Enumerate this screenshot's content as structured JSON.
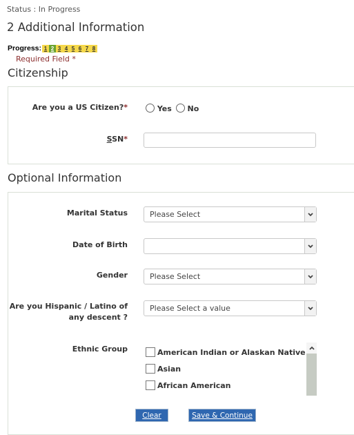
{
  "status": "Status : In Progress",
  "page_title": "2 Additional Information",
  "progress": {
    "label": "Progress:",
    "steps": [
      "1",
      "2",
      "3",
      "4",
      "5",
      "6",
      "7",
      "8"
    ],
    "current_step": 2
  },
  "required_note": "Required Field",
  "required_marker": "*",
  "citizenship": {
    "title": "Citizenship",
    "us_citizen": {
      "label": "Are you a US Citizen?",
      "options": [
        "Yes",
        "No"
      ],
      "selected": null
    },
    "ssn": {
      "label_underlined": "S",
      "label_rest": "SN",
      "value": ""
    }
  },
  "optional": {
    "title": "Optional Information",
    "marital_status": {
      "label": "Marital Status",
      "value": "Please Select"
    },
    "dob": {
      "label": "Date of Birth",
      "value": ""
    },
    "gender": {
      "label": "Gender",
      "value": "Please Select"
    },
    "hispanic": {
      "label_line1": "Are you Hispanic / Latino of",
      "label_line2": "any descent ?",
      "value": "Please Select a value"
    },
    "ethnic_group": {
      "label": "Ethnic Group",
      "options": [
        "American Indian or Alaskan Native",
        "Asian",
        "African American"
      ]
    }
  },
  "buttons": {
    "clear": "Clear",
    "save": "Save & Continue"
  },
  "colors": {
    "button": "#2f67b0",
    "required": "#8b2c2c",
    "progress_bg": "#f5d84a",
    "progress_active": "#6aa330"
  }
}
